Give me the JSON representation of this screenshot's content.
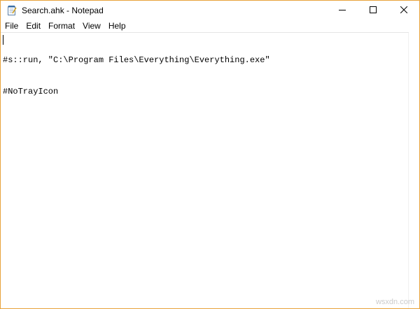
{
  "window": {
    "title": "Search.ahk - Notepad",
    "border_color": "#e8a33a"
  },
  "titlebar": {
    "app_icon": "notepad-icon",
    "controls": [
      "minimize-icon",
      "maximize-icon",
      "close-icon"
    ]
  },
  "menubar": {
    "items": [
      {
        "label": "File"
      },
      {
        "label": "Edit"
      },
      {
        "label": "Format"
      },
      {
        "label": "View"
      },
      {
        "label": "Help"
      }
    ]
  },
  "editor": {
    "lines": [
      "#s::run, \"C:\\Program Files\\Everything\\Everything.exe\"",
      "#NoTrayIcon"
    ]
  },
  "watermark": {
    "text": "wsxdn.com",
    "color": "#cccccc"
  }
}
